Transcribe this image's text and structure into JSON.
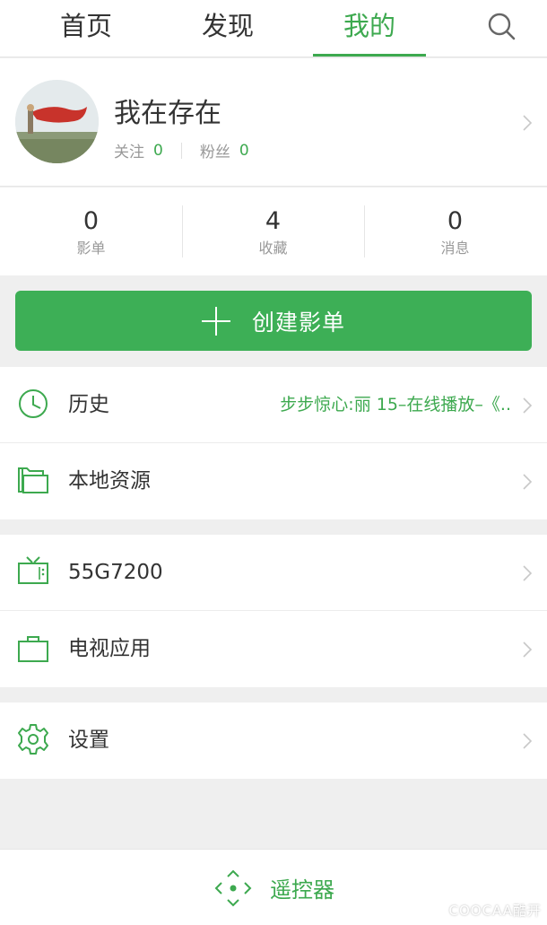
{
  "tabs": [
    {
      "label": "首页",
      "active": false
    },
    {
      "label": "发现",
      "active": false
    },
    {
      "label": "我的",
      "active": true
    }
  ],
  "search_icon": "search-icon",
  "profile": {
    "username": "我在存在",
    "following_label": "关注",
    "following_count": "0",
    "fans_label": "粉丝",
    "fans_count": "0"
  },
  "stats": [
    {
      "value": "0",
      "label": "影单"
    },
    {
      "value": "4",
      "label": "收藏"
    },
    {
      "value": "0",
      "label": "消息"
    }
  ],
  "create_button": {
    "label": "创建影单",
    "icon": "plus-icon"
  },
  "menu": {
    "history": {
      "label": "历史",
      "detail": "步步惊心:丽 15–在线播放–《..",
      "icon": "clock-icon"
    },
    "local": {
      "label": "本地资源",
      "icon": "folder-icon"
    },
    "device": {
      "label": "55G7200",
      "icon": "tv-icon"
    },
    "tv_apps": {
      "label": "电视应用",
      "icon": "bag-icon"
    },
    "settings": {
      "label": "设置",
      "icon": "gear-icon"
    }
  },
  "remote": {
    "label": "遥控器",
    "icon": "remote-dpad-icon"
  },
  "watermark": "COOCAA酷开",
  "colors": {
    "accent": "#3da94f",
    "button": "#3daf56",
    "background": "#efefef"
  }
}
